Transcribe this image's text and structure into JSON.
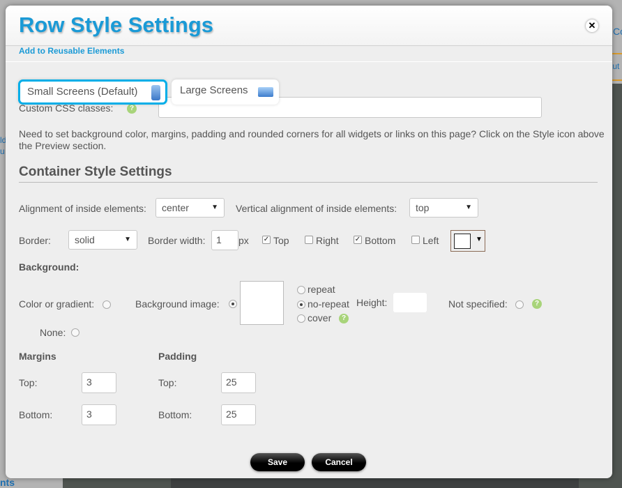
{
  "background": {
    "frag_top_right": "Co",
    "frag_right": "tut",
    "frag_left1": "ld",
    "frag_left2": "u",
    "frag_bottom_left": "nts"
  },
  "dialog": {
    "title": "Row Style Settings",
    "close_icon": "close-icon",
    "add_reusable_link": "Add to Reusable Elements"
  },
  "tabs": [
    {
      "label": "Small Screens (Default)",
      "icon": "mobile-icon",
      "active": true
    },
    {
      "label": "Large Screens",
      "icon": "monitor-icon",
      "active": false
    }
  ],
  "custom_css": {
    "label": "Custom CSS classes:",
    "value": ""
  },
  "hint": "Need to set background color, margins, padding and rounded corners for all widgets or links on this page? Click on the Style icon above the Preview section.",
  "section_title": "Container Style Settings",
  "alignment": {
    "label": "Alignment of inside elements:",
    "value": "center"
  },
  "vertical_alignment": {
    "label": "Vertical alignment of inside elements:",
    "value": "top"
  },
  "border": {
    "label": "Border:",
    "style": "solid",
    "width_label": "Border width:",
    "width": "1",
    "unit": "px",
    "sides": [
      {
        "label": "Top",
        "checked": true
      },
      {
        "label": "Right",
        "checked": false
      },
      {
        "label": "Bottom",
        "checked": true
      },
      {
        "label": "Left",
        "checked": false
      }
    ],
    "color": "#ffffff"
  },
  "background_settings": {
    "label": "Background:",
    "color_label": "Color or gradient:",
    "image_label": "Background image:",
    "repeat": "repeat",
    "no_repeat": "no-repeat",
    "cover": "cover",
    "height_label": "Height:",
    "height": "",
    "not_specified": "Not specified:",
    "none": "None:",
    "selected": "Background image",
    "repeat_selected": "no-repeat"
  },
  "margins": {
    "title": "Margins",
    "top_label": "Top:",
    "top": "3",
    "bottom_label": "Bottom:",
    "bottom": "3"
  },
  "padding": {
    "title": "Padding",
    "top_label": "Top:",
    "top": "25",
    "bottom_label": "Bottom:",
    "bottom": "25"
  },
  "buttons": {
    "save": "Save",
    "cancel": "Cancel"
  },
  "colors": {
    "accent": "#1a9ad6",
    "tab_active_border": "#00aee8",
    "help": "#a8d47a"
  }
}
